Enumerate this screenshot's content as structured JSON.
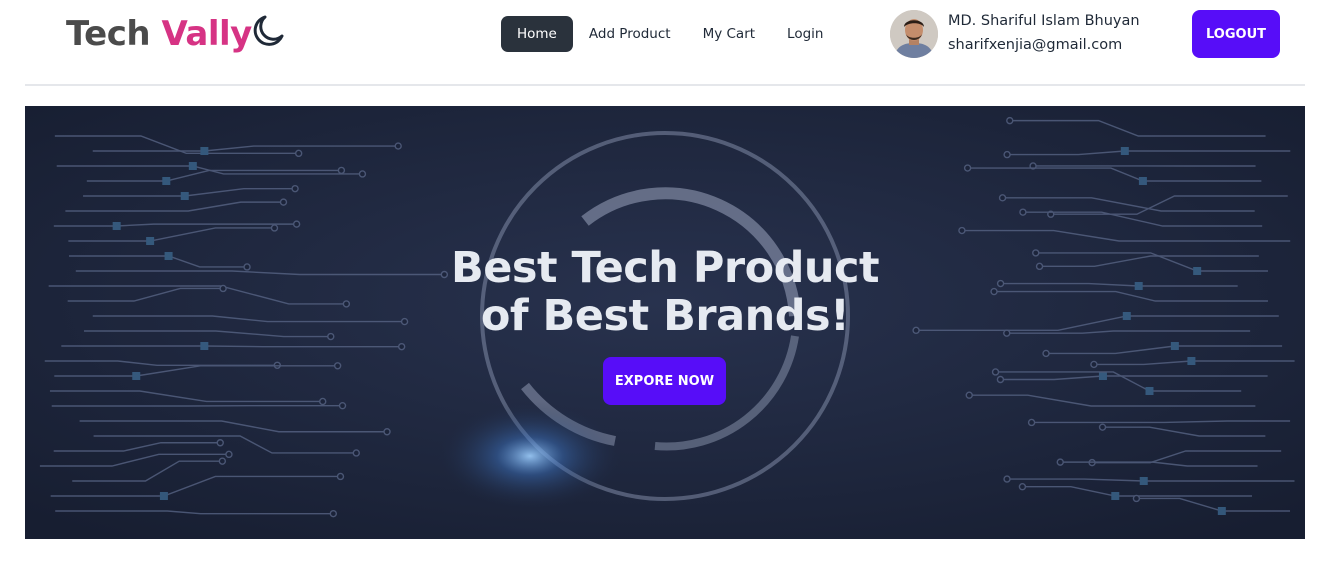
{
  "brand": {
    "part1": "Tech ",
    "part2": "Vally"
  },
  "theme_toggle": {
    "icon": "moon-icon"
  },
  "nav": {
    "items": [
      {
        "label": "Home",
        "active": true
      },
      {
        "label": "Add Product",
        "active": false
      },
      {
        "label": "My Cart",
        "active": false
      },
      {
        "label": "Login",
        "active": false
      }
    ]
  },
  "user": {
    "name": "MD. Shariful Islam Bhuyan",
    "email": "sharifxenjia@gmail.com",
    "avatar_icon": "user-avatar"
  },
  "logout": {
    "label": "LOGOUT"
  },
  "hero": {
    "title_line1": "Best Tech Product",
    "title_line2": "of Best Brands!",
    "cta_label": "EXPORE NOW"
  },
  "colors": {
    "brand_primary": "#4b4b4b",
    "brand_accent": "#d63384",
    "button_primary": "#570df8",
    "nav_active_bg": "#2a323c",
    "hero_bg": "#1b2339"
  }
}
